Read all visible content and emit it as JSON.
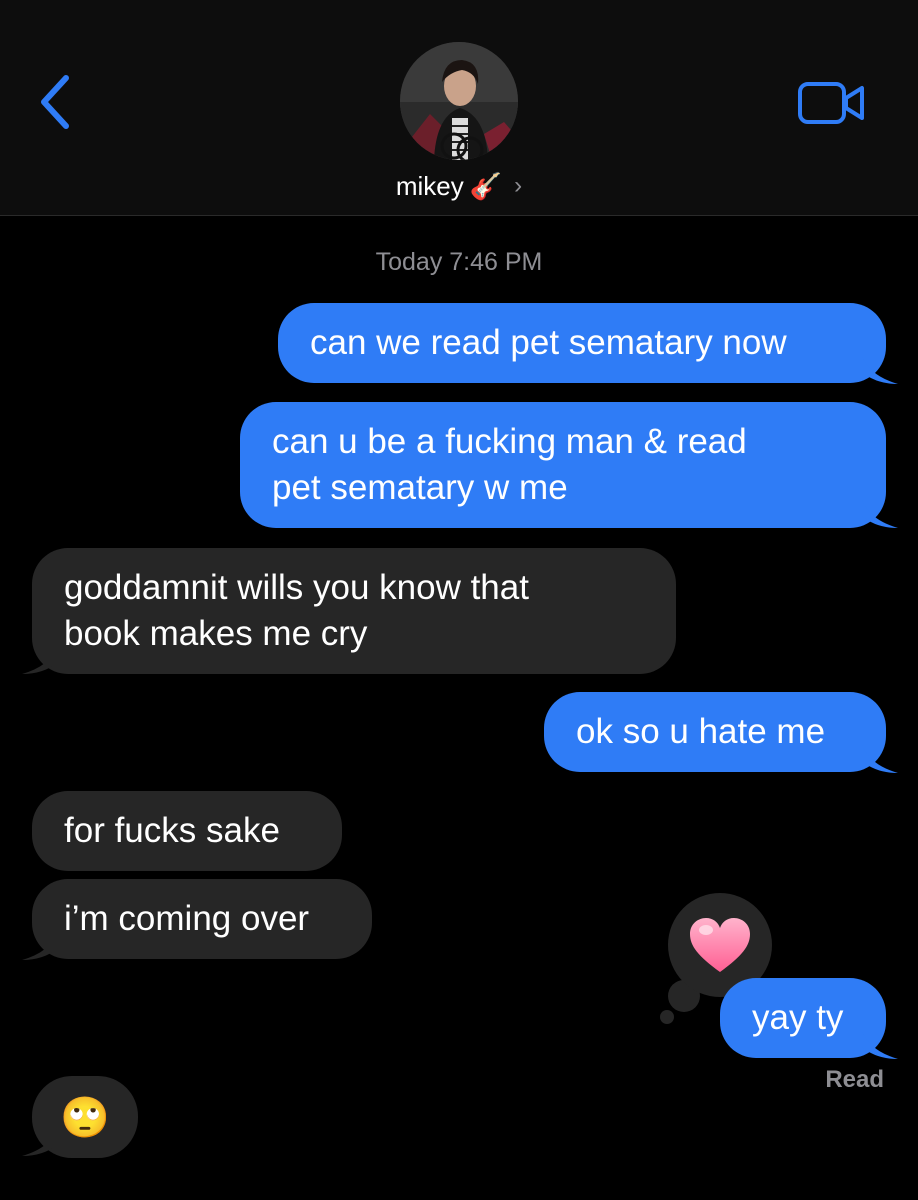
{
  "header": {
    "contact_name": "mikey",
    "contact_emoji": "🎸",
    "chevron": "›"
  },
  "timestamp": "Today 7:46 PM",
  "messages": [
    {
      "direction": "sent",
      "text": "can we read pet sematary now"
    },
    {
      "direction": "sent",
      "line1": "can u be a fucking man & read",
      "line2": "pet sematary w me"
    },
    {
      "direction": "received",
      "line1": "goddamnit wills you know that",
      "line2": "book makes me cry"
    },
    {
      "direction": "sent",
      "text": "ok so u hate me"
    },
    {
      "direction": "received",
      "text": "for fucks sake"
    },
    {
      "direction": "received",
      "text": "i’m coming over"
    },
    {
      "direction": "sent",
      "text": "yay ty"
    },
    {
      "direction": "received",
      "text": "🙄"
    }
  ],
  "tapback": {
    "emoji": "heart",
    "color": "#ff7aa8"
  },
  "read_receipt": "Read",
  "colors": {
    "sent_bubble": "#2f7cf6",
    "received_bubble": "#262626",
    "accent": "#2f7cf6",
    "background": "#000000"
  },
  "icons": {
    "back": "back-chevron-icon",
    "video": "video-camera-icon"
  }
}
